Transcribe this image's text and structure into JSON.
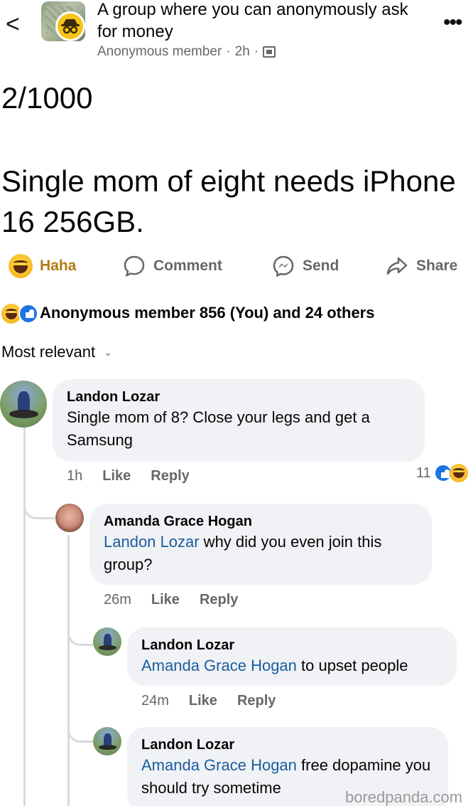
{
  "header": {
    "back_glyph": "<",
    "group_name": "A group where you can anonymously ask for money",
    "author": "Anonymous member",
    "time": "2h",
    "separator": "·",
    "more_glyph": "•••",
    "privacy_icon": "group-icon",
    "badge_icon": "anonymous-icon"
  },
  "post": {
    "count": "2/1000",
    "text": "Single mom of eight needs iPhone 16 256GB."
  },
  "actions": {
    "haha": "Haha",
    "comment": "Comment",
    "send": "Send",
    "share": "Share"
  },
  "reactions_summary": "Anonymous member 856 (You) and 24 others",
  "sort_label": "Most relevant",
  "comments": [
    {
      "name": "Landon Lozar",
      "mention": "",
      "text": "Single mom of 8? Close your legs and get a Samsung",
      "time": "1h",
      "like": "Like",
      "reply": "Reply",
      "reaction_count": "11"
    },
    {
      "name": "Amanda Grace Hogan",
      "mention": "Landon Lozar",
      "text": " why did you even join this group?",
      "time": "26m",
      "like": "Like",
      "reply": "Reply"
    },
    {
      "name": "Landon Lozar",
      "mention": "Amanda Grace Hogan",
      "text": " to upset people",
      "time": "24m",
      "like": "Like",
      "reply": "Reply"
    },
    {
      "name": "Landon Lozar",
      "mention": "Amanda Grace Hogan",
      "text": " free dopamine you should try sometime"
    }
  ],
  "watermark": "boredpanda.com",
  "colors": {
    "mention": "#1a5c9e",
    "bubble": "#f0f2f5",
    "secondary_text": "#65676b",
    "like_blue": "#1b74e4",
    "haha_yellow": "#f6b51e"
  }
}
